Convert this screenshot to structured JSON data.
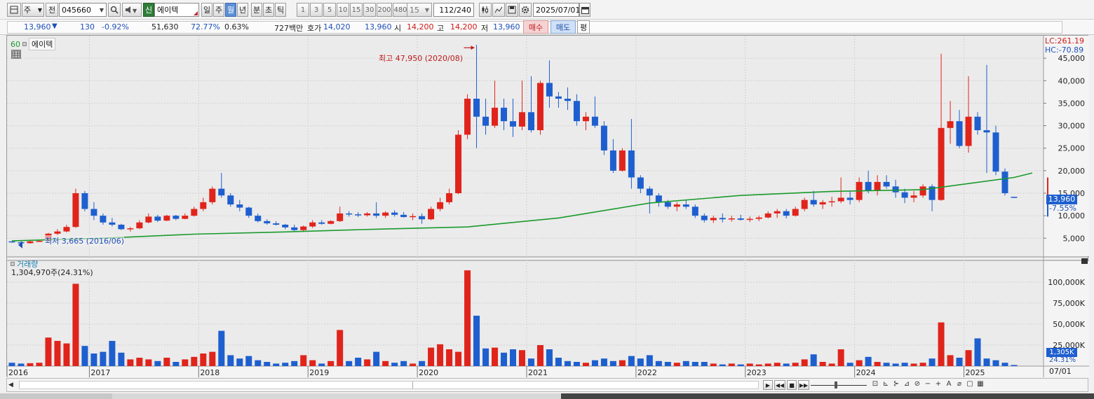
{
  "toolbar": {
    "type_label": "주",
    "prev_label": "전",
    "stock_code": "045660",
    "new_badge": "신",
    "stock_name": "에이텍",
    "periods": [
      "일",
      "주",
      "월",
      "년",
      "분",
      "초",
      "틱"
    ],
    "active_period": "월",
    "intervals": [
      "1",
      "3",
      "5",
      "10",
      "15",
      "30",
      "200",
      "480"
    ],
    "interval_value": "15",
    "count": "112",
    "count_total": "/240",
    "date": "2025/07/01"
  },
  "quote": {
    "price": "13,960",
    "change_arrow": "▼",
    "change": "130",
    "change_pct": "-0.92%",
    "volume": "51,630",
    "ratio1": "72.77%",
    "ratio2": "0.63%",
    "amount": "727백만",
    "hoga_label": "호가",
    "ask": "14,020",
    "bid": "13,960",
    "open_label": "시",
    "open": "14,200",
    "high_label": "고",
    "high": "14,200",
    "low_label": "저",
    "low": "13,960",
    "buy_label": "매수",
    "sell_label": "매도",
    "eval_label": "평"
  },
  "price_panel": {
    "ma_period": "60",
    "stock_name": "에이텍",
    "lc_label": "LC:261.19",
    "hc_label": "HC:-70.89",
    "high_annotation": "최고 47,950 (2020/08)",
    "low_annotation": "최저 3,665 (2016/06)",
    "current_price_tag": "13,960",
    "current_pct_tag": "-7.55%",
    "y_ticks": [
      "45,000",
      "40,000",
      "35,000",
      "30,000",
      "25,000",
      "20,000",
      "15,000",
      "10,000",
      "5,000"
    ]
  },
  "volume_panel": {
    "title": "거래량",
    "value_label": "1,304,970주(24.31%)",
    "current_tag": "1,305K",
    "current_pct_tag": "24.31%",
    "y_ticks": [
      "100,000K",
      "75,000K",
      "50,000K",
      "25,000K"
    ]
  },
  "x_axis": {
    "labels": [
      "2016",
      "2017",
      "2018",
      "2019",
      "2020",
      "2021",
      "2022",
      "2023",
      "2024",
      "2025"
    ],
    "end_label": "07/01"
  },
  "colors": {
    "up": "#e0241b",
    "down": "#1e5fcf",
    "ma": "#1a9a2c"
  },
  "chart_data": {
    "type": "candlestick",
    "title": "",
    "interval": "monthly",
    "ma_period": 60,
    "ylim": [
      1000,
      50000
    ],
    "volume_ylim": [
      0,
      125000
    ],
    "volume_unit": "K",
    "candles": [
      [
        4300,
        4300,
        4000,
        4100,
        4000
      ],
      [
        4100,
        4300,
        3665,
        3900,
        3000
      ],
      [
        3900,
        4500,
        3800,
        4300,
        3500
      ],
      [
        4300,
        4600,
        4200,
        4400,
        4000
      ],
      [
        4400,
        6200,
        4300,
        6000,
        34000
      ],
      [
        6000,
        7000,
        5700,
        6500,
        30000
      ],
      [
        6500,
        8000,
        6300,
        7500,
        27000
      ],
      [
        7500,
        16000,
        7300,
        15000,
        98000
      ],
      [
        15000,
        15500,
        11000,
        11500,
        24000
      ],
      [
        11500,
        13000,
        9000,
        10000,
        15000
      ],
      [
        10000,
        10500,
        8000,
        8500,
        17000
      ],
      [
        8500,
        9500,
        7600,
        8000,
        30000
      ],
      [
        8000,
        8200,
        6800,
        7000,
        16000
      ],
      [
        7000,
        7500,
        6500,
        7200,
        8000
      ],
      [
        7200,
        9000,
        7000,
        8500,
        10000
      ],
      [
        8500,
        10500,
        8300,
        9800,
        8000
      ],
      [
        9800,
        10200,
        8600,
        8900,
        6000
      ],
      [
        8900,
        10200,
        8800,
        10000,
        10000
      ],
      [
        10000,
        10200,
        9000,
        9300,
        5000
      ],
      [
        9300,
        10500,
        9200,
        10000,
        8000
      ],
      [
        10000,
        12000,
        9800,
        11500,
        11000
      ],
      [
        11500,
        14000,
        11000,
        13000,
        15000
      ],
      [
        13000,
        16500,
        12500,
        16000,
        17000
      ],
      [
        16000,
        19500,
        14000,
        14500,
        42000
      ],
      [
        14500,
        15000,
        12000,
        12500,
        13000
      ],
      [
        12500,
        13500,
        11000,
        11800,
        9000
      ],
      [
        11800,
        12000,
        9500,
        10000,
        12000
      ],
      [
        10000,
        10500,
        8500,
        8800,
        7000
      ],
      [
        8800,
        9200,
        8000,
        8300,
        5000
      ],
      [
        8300,
        8800,
        7800,
        8000,
        3000
      ],
      [
        8000,
        8200,
        7000,
        7400,
        4000
      ],
      [
        7400,
        8000,
        6500,
        6800,
        6000
      ],
      [
        6800,
        7800,
        6400,
        7600,
        13000
      ],
      [
        7600,
        9000,
        7300,
        8500,
        7000
      ],
      [
        8500,
        9000,
        8000,
        8200,
        3000
      ],
      [
        8200,
        9000,
        8100,
        8800,
        6000
      ],
      [
        8800,
        12000,
        8600,
        10500,
        43000
      ],
      [
        10500,
        11000,
        9800,
        10300,
        6000
      ],
      [
        10300,
        10800,
        9700,
        10100,
        10000
      ],
      [
        10100,
        10800,
        9800,
        10500,
        8000
      ],
      [
        10500,
        13000,
        9500,
        10000,
        17000
      ],
      [
        10000,
        11000,
        9500,
        10700,
        6000
      ],
      [
        10700,
        11200,
        9800,
        10200,
        4000
      ],
      [
        10200,
        10800,
        9600,
        9700,
        6000
      ],
      [
        9700,
        10500,
        9000,
        9900,
        3000
      ],
      [
        9900,
        10500,
        8200,
        9200,
        6000
      ],
      [
        9200,
        12000,
        9000,
        11500,
        22000
      ],
      [
        11500,
        14000,
        11000,
        13000,
        26000
      ],
      [
        13000,
        16000,
        12500,
        15000,
        20000
      ],
      [
        15000,
        29000,
        14800,
        28000,
        17000
      ],
      [
        28000,
        37000,
        27000,
        36000,
        114000
      ],
      [
        36000,
        47950,
        25000,
        32000,
        60000
      ],
      [
        32000,
        36000,
        28000,
        30000,
        21000
      ],
      [
        30000,
        40000,
        29500,
        34000,
        22000
      ],
      [
        34000,
        36000,
        29000,
        31000,
        16000
      ],
      [
        31000,
        36000,
        27500,
        29800,
        20000
      ],
      [
        29800,
        40000,
        29000,
        33000,
        19000
      ],
      [
        33000,
        41000,
        28500,
        29000,
        9000
      ],
      [
        29000,
        40000,
        28000,
        39500,
        25000
      ],
      [
        39500,
        44500,
        34000,
        36500,
        20000
      ],
      [
        36500,
        37500,
        34000,
        36000,
        10000
      ],
      [
        36000,
        38500,
        33500,
        35500,
        6000
      ],
      [
        35500,
        37000,
        30000,
        31000,
        5000
      ],
      [
        31000,
        33000,
        29000,
        32000,
        4000
      ],
      [
        32000,
        36500,
        29500,
        30000,
        7000
      ],
      [
        30000,
        31000,
        23500,
        24500,
        9000
      ],
      [
        24500,
        27000,
        19500,
        20000,
        6000
      ],
      [
        20000,
        25000,
        19800,
        24500,
        7000
      ],
      [
        24500,
        31500,
        16000,
        18500,
        12000
      ],
      [
        18500,
        19000,
        15000,
        16000,
        9000
      ],
      [
        16000,
        16500,
        10500,
        14500,
        13000
      ],
      [
        14500,
        15000,
        12000,
        13000,
        6000
      ],
      [
        13000,
        13500,
        11500,
        12000,
        5000
      ],
      [
        12000,
        13000,
        11000,
        12500,
        4000
      ],
      [
        12500,
        13500,
        11500,
        12000,
        6000
      ],
      [
        12000,
        12500,
        9500,
        10000,
        5000
      ],
      [
        10000,
        10500,
        8500,
        9000,
        5000
      ],
      [
        9000,
        10000,
        8400,
        9500,
        3000
      ],
      [
        9500,
        10500,
        8500,
        9200,
        2000
      ],
      [
        9200,
        10000,
        8700,
        9400,
        3000
      ],
      [
        9400,
        10200,
        8900,
        9100,
        2000
      ],
      [
        9100,
        9800,
        8600,
        9300,
        3000
      ],
      [
        9300,
        10000,
        8800,
        9600,
        2000
      ],
      [
        9600,
        11000,
        9400,
        10500,
        3000
      ],
      [
        10500,
        11500,
        9500,
        11000,
        4000
      ],
      [
        11000,
        11500,
        9400,
        10000,
        3000
      ],
      [
        10000,
        12000,
        9800,
        11500,
        4000
      ],
      [
        11500,
        14000,
        11000,
        13500,
        8000
      ],
      [
        13500,
        15500,
        12000,
        12500,
        14000
      ],
      [
        12500,
        13500,
        11500,
        13000,
        5000
      ],
      [
        13000,
        14200,
        12000,
        13200,
        3000
      ],
      [
        13200,
        18500,
        12800,
        14000,
        20000
      ],
      [
        14000,
        15500,
        12500,
        13500,
        4000
      ],
      [
        13500,
        18500,
        13000,
        17500,
        7000
      ],
      [
        17500,
        20000,
        15000,
        15500,
        11000
      ],
      [
        15500,
        19000,
        14500,
        17500,
        5000
      ],
      [
        17500,
        19000,
        16000,
        16500,
        4000
      ],
      [
        16500,
        18000,
        14000,
        15200,
        3000
      ],
      [
        15200,
        16000,
        12800,
        14000,
        4000
      ],
      [
        14000,
        15500,
        13000,
        14500,
        3000
      ],
      [
        14500,
        17000,
        14000,
        16500,
        4000
      ],
      [
        16500,
        17000,
        11000,
        13500,
        9000
      ],
      [
        13500,
        46000,
        13300,
        29500,
        52000
      ],
      [
        29500,
        35500,
        26000,
        31000,
        13000
      ],
      [
        31000,
        33500,
        25000,
        25500,
        10000
      ],
      [
        25500,
        41000,
        24000,
        32000,
        19000
      ],
      [
        32000,
        33000,
        28000,
        29000,
        33000
      ],
      [
        29000,
        43500,
        19500,
        28500,
        9000
      ],
      [
        28500,
        30000,
        19000,
        19800,
        7000
      ],
      [
        19800,
        20500,
        14500,
        15000,
        4000
      ],
      [
        14200,
        14200,
        13960,
        13960,
        1305
      ]
    ],
    "ma60": [
      [
        0,
        4400
      ],
      [
        10,
        5000
      ],
      [
        20,
        5900
      ],
      [
        30,
        6400
      ],
      [
        40,
        7000
      ],
      [
        50,
        7500
      ],
      [
        60,
        9500
      ],
      [
        70,
        12800
      ],
      [
        80,
        14500
      ],
      [
        90,
        15400
      ],
      [
        100,
        15800
      ],
      [
        110,
        18500
      ],
      [
        112,
        19500
      ]
    ]
  }
}
